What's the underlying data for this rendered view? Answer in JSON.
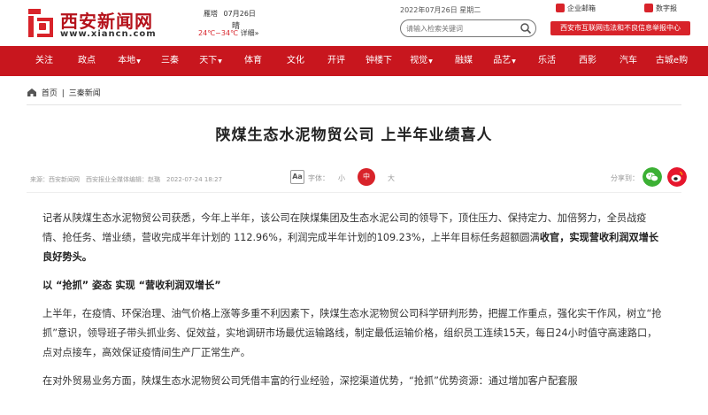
{
  "header": {
    "logo_title": "西安新闻网",
    "logo_url": "www.xiancn.com",
    "weather": {
      "location": "雁塔",
      "date": "07月26日",
      "condition": "晴",
      "temp": "24℃~34℃",
      "detail_link": "详细»"
    },
    "date_line": "2022年07月26日 星期二",
    "search_placeholder": "请输入检索关键词",
    "links": {
      "enterprise_mail": "企业邮箱",
      "digital_paper": "数字报"
    },
    "report_button": "西安市互联网违法和不良信息举报中心"
  },
  "nav": {
    "items": [
      {
        "label": "关注"
      },
      {
        "label": "政点"
      },
      {
        "label": "本地"
      },
      {
        "label": "三秦"
      },
      {
        "label": "天下"
      },
      {
        "label": "体育"
      },
      {
        "label": "文化"
      },
      {
        "label": "开评"
      },
      {
        "label": "钟楼下"
      },
      {
        "label": "视觉"
      },
      {
        "label": "融媒"
      },
      {
        "label": "品艺"
      },
      {
        "label": "乐活"
      },
      {
        "label": "西影"
      },
      {
        "label": "汽车"
      },
      {
        "label": "古城e购"
      }
    ]
  },
  "breadcrumb": {
    "home": "首页",
    "separator": "|",
    "current": "三秦新闻"
  },
  "article": {
    "title": "陕煤生态水泥物贸公司 上半年业绩喜人",
    "meta": "来源：西安新闻网　西安报业全媒体编辑：赵璐　2022-07-24 18:27",
    "font_label": "字体：",
    "font_small": "小",
    "font_medium": "中",
    "font_large": "大",
    "font_icon_text": "Aa",
    "share_label": "分享到：",
    "para1_normal": "记者从陕煤生态水泥物贸公司获悉，今年上半年，该公司在陕煤集团及生态水泥公司的领导下，顶住压力、保持定力、加倍努力，全员战疫情、抢任务、增业绩，营收完成半年计划的 112.96%，利润完成半年计划的109.23%，上半年目标任务超额圆满",
    "para1_bold": "收官，实现营收利润双增长良好势头。",
    "section_heading": "以 “抢抓” 姿态 实现 “营收利润双增长”",
    "para2": "上半年，在疫情、环保治理、油气价格上涨等多重不利因素下，陕煤生态水泥物贸公司科学研判形势，把握工作重点，强化实干作风，树立“抢抓”意识，领导班子带头抓业务、促效益，实地调研市场最优运输路线，制定最低运输价格，组织员工连续15天，每日24小时值守高速路口，点对点接车，高效保证疫情间生产厂正常生产。",
    "para3": "在对外贸易业务方面，陕煤生态水泥物贸公司凭借丰富的行业经验，深挖渠道优势，“抢抓”优势资源：通过增加客户配套服"
  },
  "colors": {
    "brand_red": "#c8161e",
    "accent_red": "#d8232a"
  }
}
